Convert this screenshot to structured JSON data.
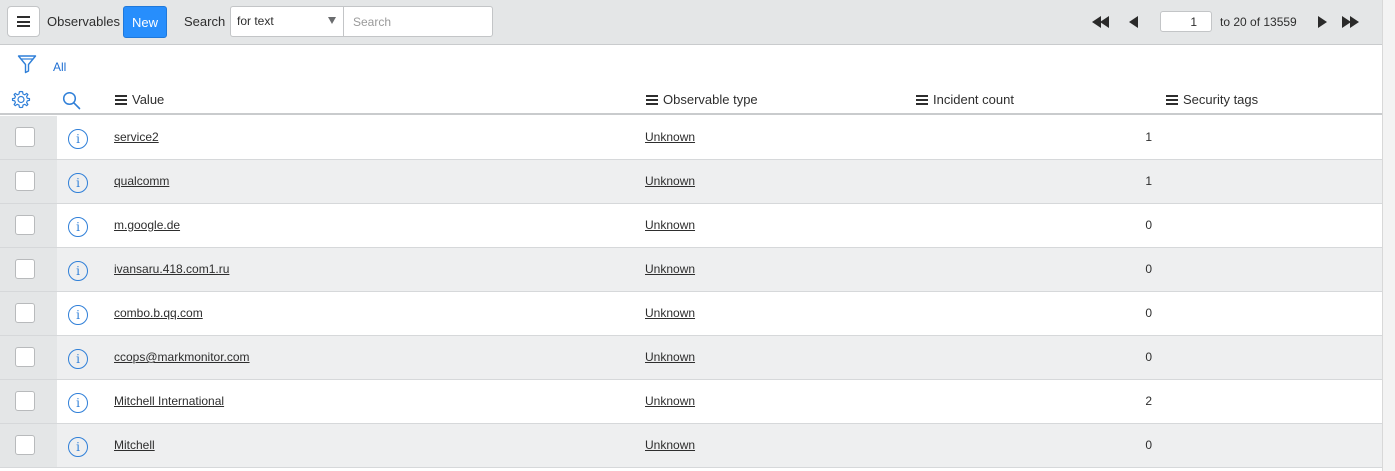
{
  "header": {
    "title": "Observables",
    "new_label": "New",
    "search_label": "Search",
    "search_field_value": "for text",
    "search_placeholder": "Search"
  },
  "pager": {
    "current_page": "1",
    "range_text": "to 20 of 13559"
  },
  "filter": {
    "label": "All"
  },
  "columns": {
    "value": "Value",
    "observable_type": "Observable type",
    "incident_count": "Incident count",
    "security_tags": "Security tags"
  },
  "rows": [
    {
      "value": "service2",
      "type": "Unknown",
      "count": "1"
    },
    {
      "value": "qualcomm",
      "type": "Unknown",
      "count": "1"
    },
    {
      "value": "m.google.de",
      "type": "Unknown",
      "count": "0"
    },
    {
      "value": "ivansaru.418.com1.ru",
      "type": "Unknown",
      "count": "0"
    },
    {
      "value": "combo.b.qq.com",
      "type": "Unknown",
      "count": "0"
    },
    {
      "value": "ccops@markmonitor.com",
      "type": "Unknown",
      "count": "0"
    },
    {
      "value": "Mitchell International",
      "type": "Unknown",
      "count": "2"
    },
    {
      "value": "Mitchell",
      "type": "Unknown",
      "count": "0"
    }
  ],
  "colors": {
    "accent": "#278efc",
    "link_icon": "#2f7fd8",
    "header_bg": "#e4e6e7"
  }
}
